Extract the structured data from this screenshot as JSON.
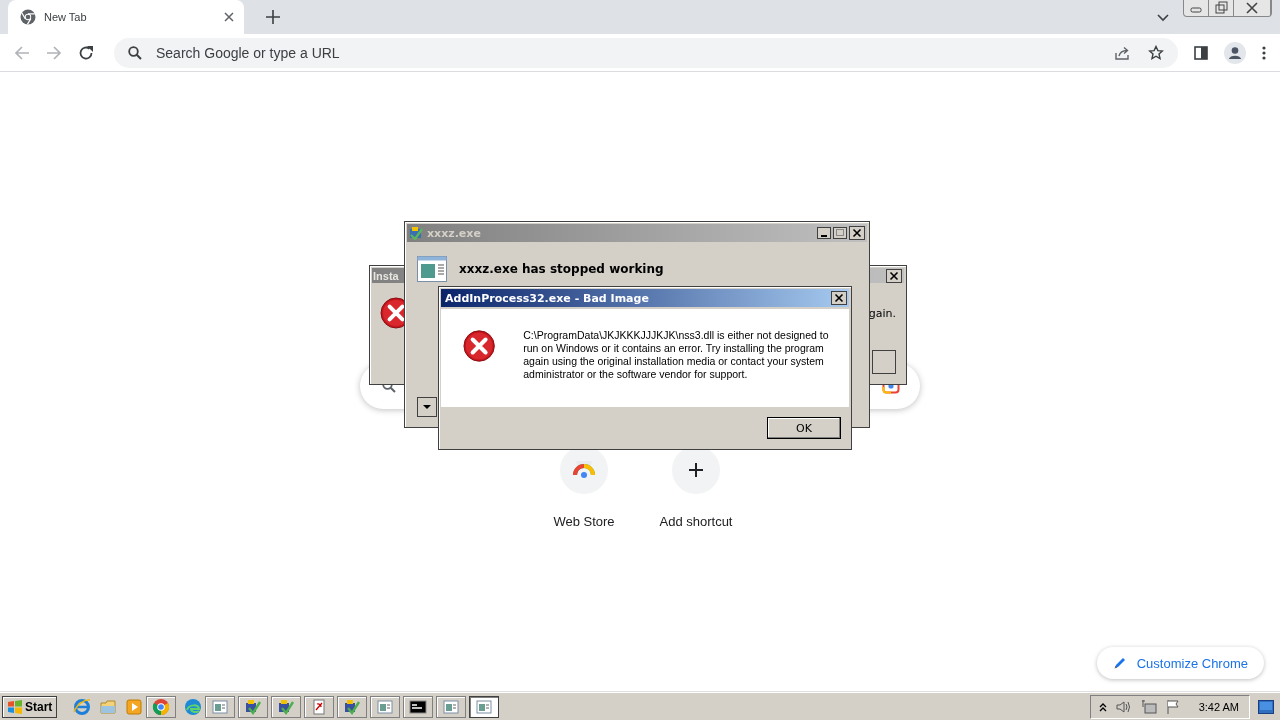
{
  "browser": {
    "tab": {
      "title": "New Tab",
      "selected": true
    },
    "address": {
      "placeholder": "Search Google or type a URL"
    }
  },
  "new_tab_page": {
    "shortcuts": [
      {
        "kind": "store",
        "label": "Web Store"
      },
      {
        "kind": "add",
        "label": "Add shortcut"
      }
    ],
    "customize": {
      "label": "Customize Chrome"
    }
  },
  "windows": [
    {
      "kind": "back",
      "title": "Insta",
      "message": "gain."
    },
    {
      "kind": "crash",
      "title": "xxxz.exe",
      "heading": "xxxz.exe has stopped working"
    },
    {
      "kind": "error",
      "title": "AddInProcess32.exe - Bad Image",
      "message": "C:\\ProgramData\\JKJKKKJJJKJK\\nss3.dll is either not designed to run on Windows or it contains an error. Try installing the program again using the original installation media or contact your system administrator or the software vendor for support.",
      "button": "OK"
    }
  ],
  "taskbar": {
    "start": "Start",
    "items": [
      {
        "kind": "ie"
      },
      {
        "kind": "folder"
      },
      {
        "kind": "media"
      },
      {
        "kind": "chrome",
        "selected": false
      },
      {
        "kind": "edge"
      },
      {
        "kind": "window",
        "selected": false
      },
      {
        "kind": "installer",
        "selected": false
      },
      {
        "kind": "installer",
        "selected": false
      },
      {
        "kind": "document",
        "selected": false
      },
      {
        "kind": "installer",
        "selected": false
      },
      {
        "kind": "window",
        "selected": false
      },
      {
        "kind": "console",
        "selected": false
      },
      {
        "kind": "window",
        "selected": false
      },
      {
        "kind": "window",
        "selected": true
      }
    ],
    "clock": "3:42 AM"
  }
}
